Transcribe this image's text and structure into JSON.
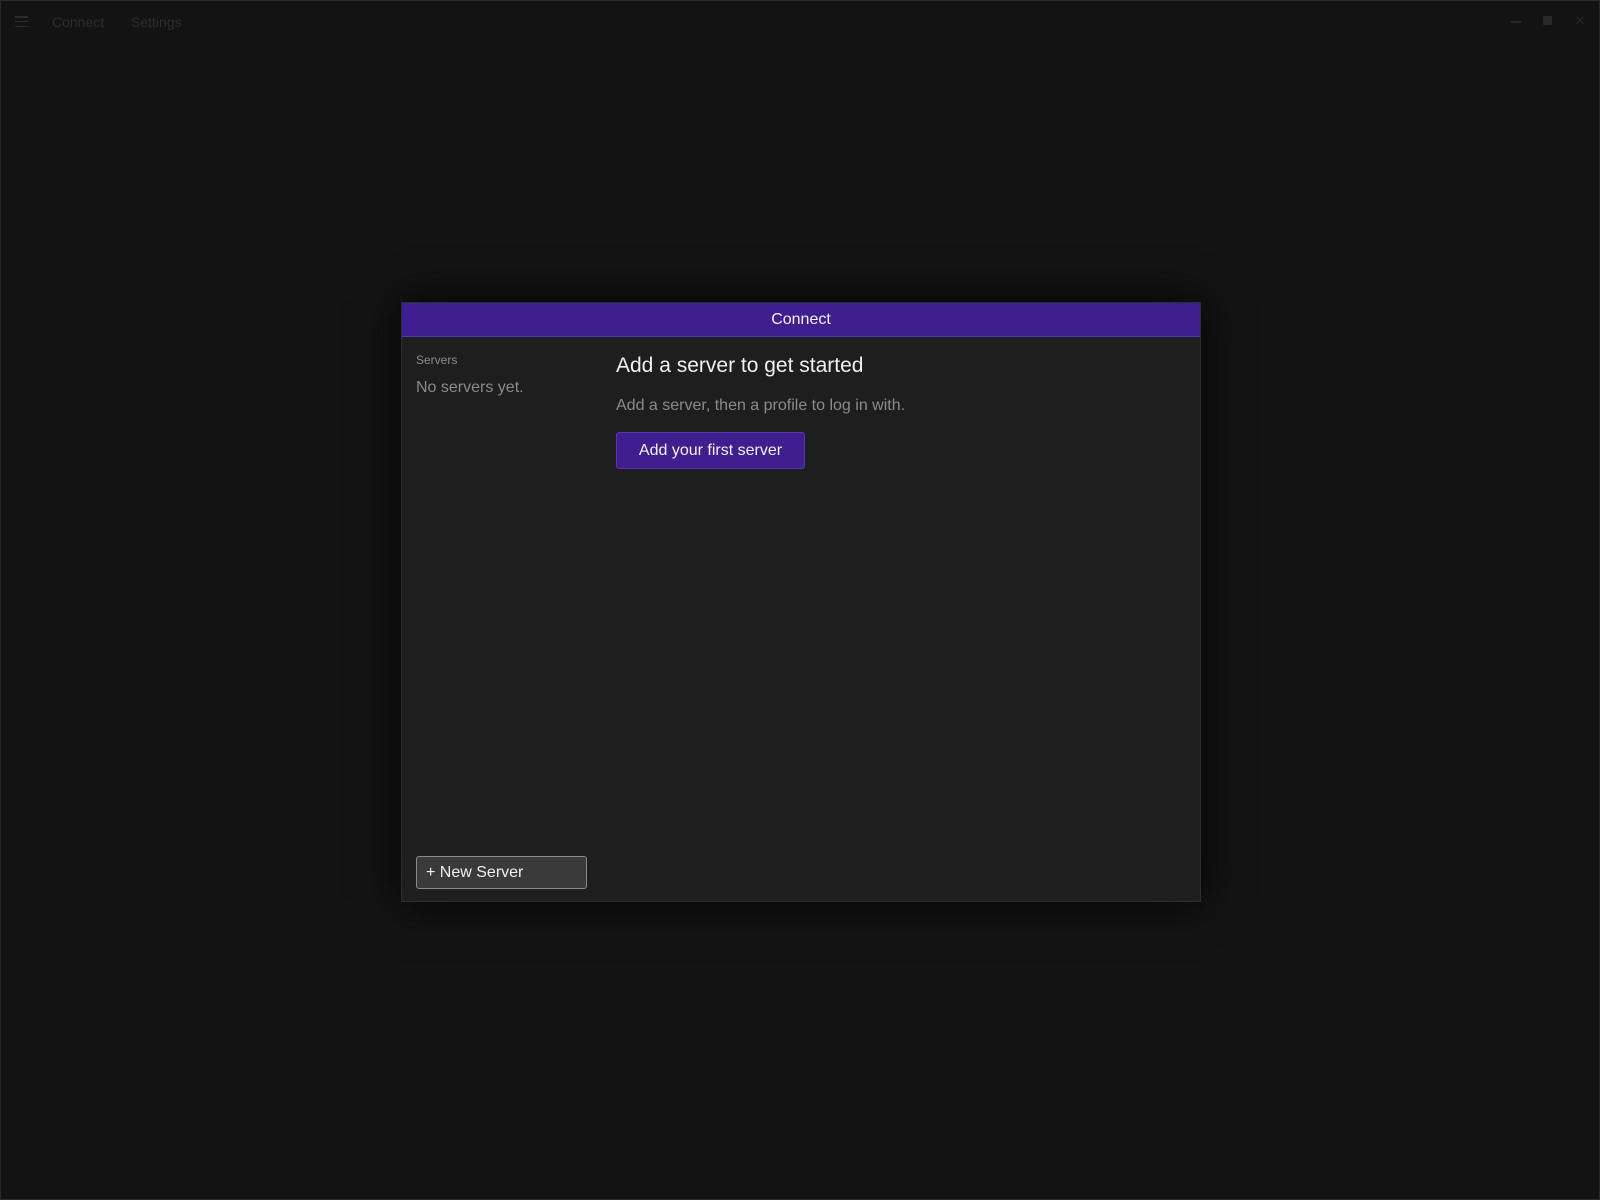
{
  "titlebar": {
    "menu_icon": "hamburger-menu-icon",
    "links": [
      "Connect",
      "Settings"
    ],
    "controls": {
      "minimize_icon": "minimize-icon",
      "maximize_icon": "maximize-icon",
      "close_icon": "close-icon",
      "close_glyph": "✕"
    }
  },
  "dialog": {
    "title": "Connect",
    "sidebar": {
      "heading": "Servers",
      "empty_text": "No servers yet.",
      "new_server_label": "+ New Server"
    },
    "main": {
      "title": "Add a server to get started",
      "subtitle": "Add a server, then a profile to log in with.",
      "button_label": "Add your first server"
    }
  },
  "colors": {
    "background": "#131313",
    "dialog_background": "#1e1e1e",
    "accent": "#3f1f8f"
  }
}
